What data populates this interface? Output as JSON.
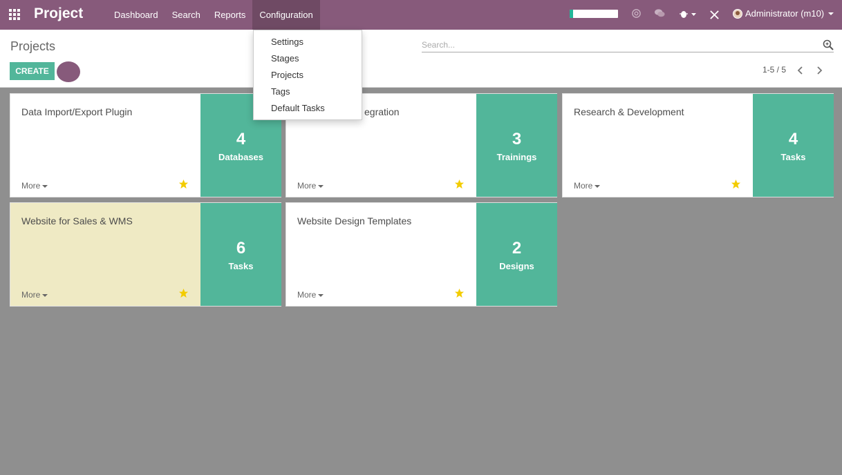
{
  "navbar": {
    "brand": "Project",
    "menu": [
      {
        "label": "Dashboard"
      },
      {
        "label": "Search"
      },
      {
        "label": "Reports"
      },
      {
        "label": "Configuration"
      }
    ],
    "progress": 0.07,
    "user": "Administrator (m10)",
    "colors": {
      "navbar": "#875a7b",
      "active": "#6f4a64"
    }
  },
  "dropdown": {
    "items": [
      "Settings",
      "Stages",
      "Projects",
      "Tags",
      "Default Tasks"
    ]
  },
  "control_panel": {
    "breadcrumb": "Projects",
    "search_placeholder": "Search...",
    "create_label": "CREATE",
    "pager": "1-5 / 5"
  },
  "kanban": {
    "more_label": "More",
    "accent": "#52b69a",
    "cards": [
      {
        "title": "Data Import/Export Plugin",
        "count": "4",
        "label": "Databases",
        "color": "white"
      },
      {
        "title": "egration",
        "count": "3",
        "label": "Trainings",
        "color": "white"
      },
      {
        "title": "Research & Development",
        "count": "4",
        "label": "Tasks",
        "color": "white"
      },
      {
        "title": "Website for Sales & WMS",
        "count": "6",
        "label": "Tasks",
        "color": "yellow"
      },
      {
        "title": "Website Design Templates",
        "count": "2",
        "label": "Designs",
        "color": "white"
      }
    ]
  }
}
